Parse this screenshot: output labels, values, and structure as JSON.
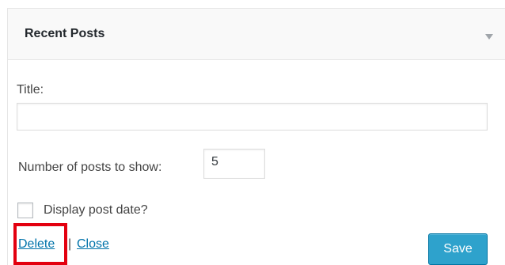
{
  "widget": {
    "title": "Recent Posts",
    "toggle_icon": "triangle-down-icon"
  },
  "form": {
    "title_label": "Title:",
    "title_value": "",
    "number_label": "Number of posts to show:",
    "number_value": "5",
    "show_date_label": "Display post date?",
    "show_date_checked": false
  },
  "actions": {
    "delete_label": "Delete",
    "separator": "|",
    "close_label": "Close",
    "save_label": "Save"
  },
  "colors": {
    "link": "#0073aa",
    "save_button": "#2ea2cc",
    "highlight": "#e3000f"
  }
}
